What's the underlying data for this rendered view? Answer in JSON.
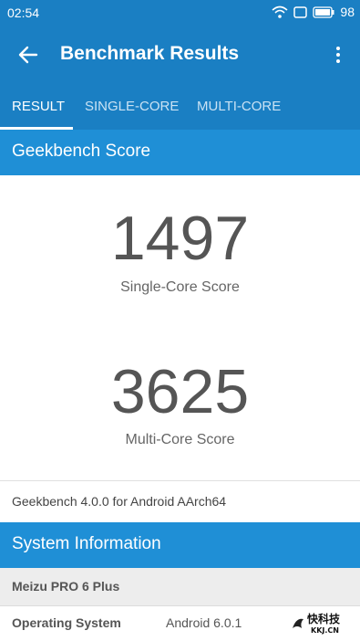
{
  "status": {
    "time": "02:54",
    "battery": "98"
  },
  "appbar": {
    "title": "Benchmark Results"
  },
  "tabs": [
    {
      "label": "RESULT",
      "active": true
    },
    {
      "label": "SINGLE-CORE",
      "active": false
    },
    {
      "label": "MULTI-CORE",
      "active": false
    }
  ],
  "geekbench": {
    "header": "Geekbench Score",
    "single_score": "1497",
    "single_label": "Single-Core Score",
    "multi_score": "3625",
    "multi_label": "Multi-Core Score",
    "version": "Geekbench 4.0.0 for Android AArch64"
  },
  "system": {
    "header": "System Information",
    "device": "Meizu PRO 6 Plus",
    "rows": [
      {
        "key": "Operating System",
        "value": "Android 6.0.1"
      }
    ]
  },
  "watermark": {
    "text": "快科技",
    "sub": "KKJ.CN"
  },
  "colors": {
    "primary": "#1a7fc3",
    "section": "#1f8fd6"
  }
}
